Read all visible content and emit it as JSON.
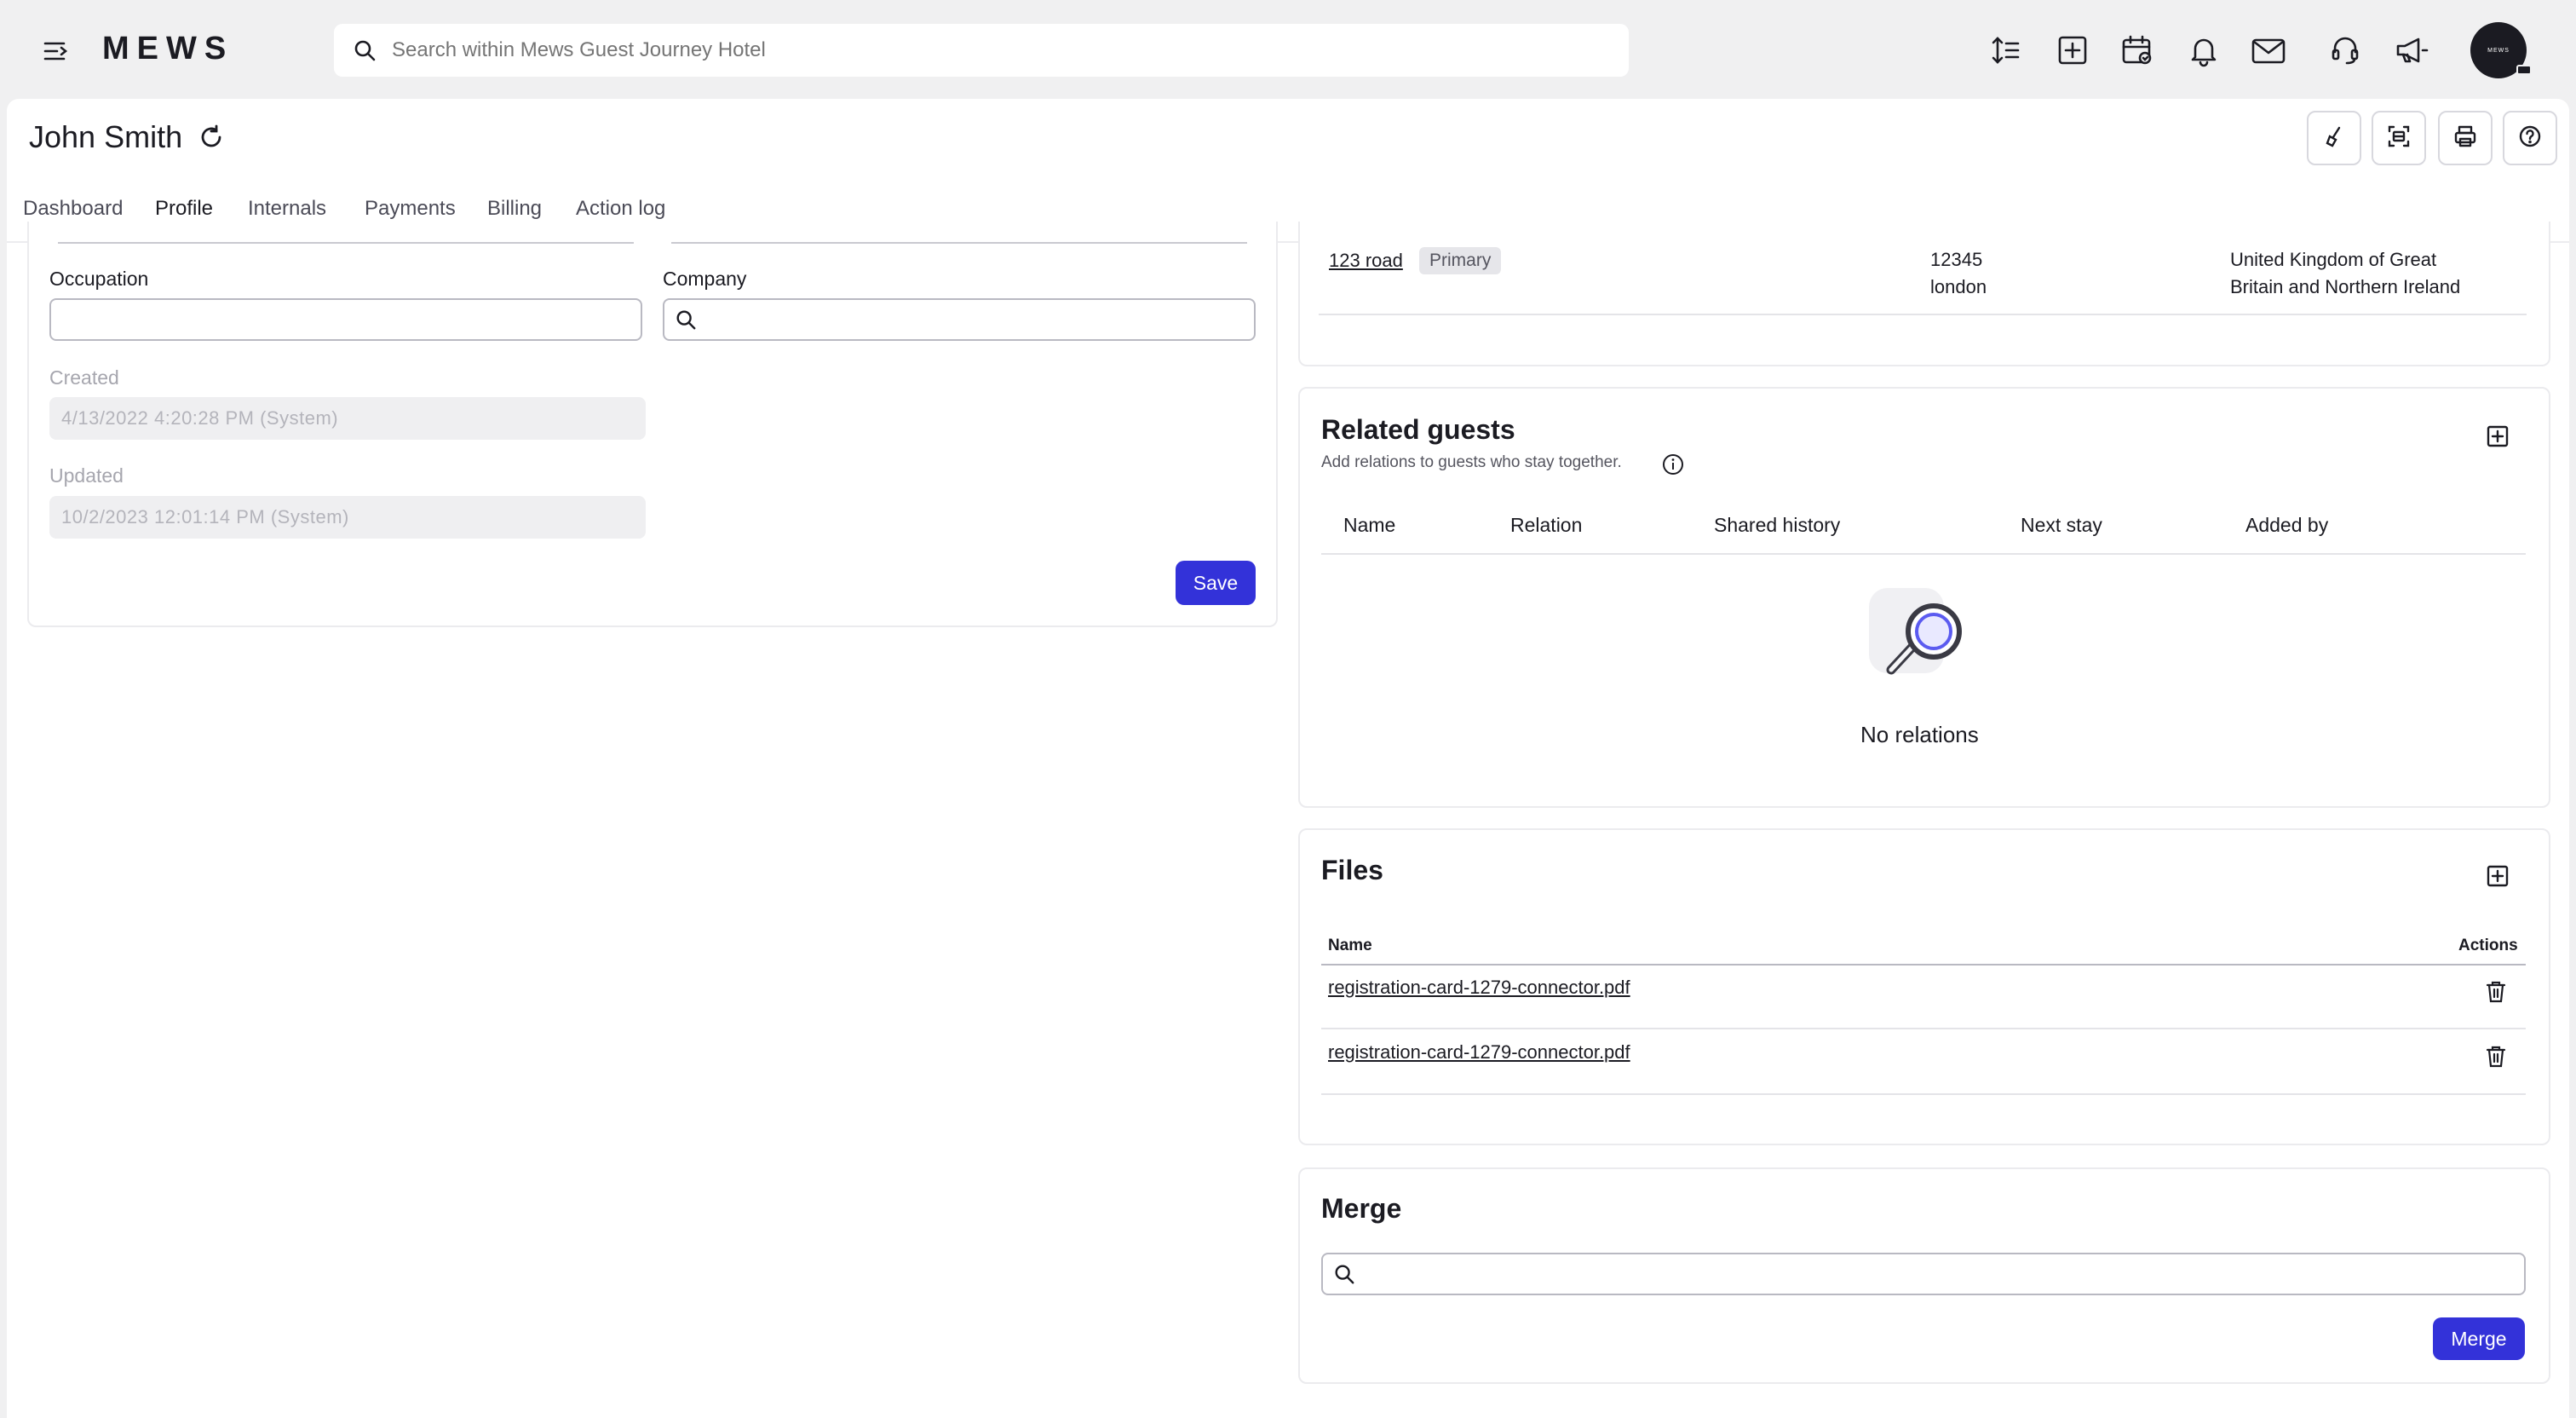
{
  "app": {
    "logo": "MEWS",
    "avatar_text": "MEWS"
  },
  "search": {
    "placeholder": "Search within Mews Guest Journey Hotel"
  },
  "header": {
    "title": "John Smith"
  },
  "tabs": [
    {
      "label": "Dashboard"
    },
    {
      "label": "Profile"
    },
    {
      "label": "Internals"
    },
    {
      "label": "Payments"
    },
    {
      "label": "Billing"
    },
    {
      "label": "Action log"
    }
  ],
  "active_tab": "Profile",
  "profile_form": {
    "occupation_label": "Occupation",
    "occupation_value": "",
    "company_label": "Company",
    "company_value": "",
    "created_label": "Created",
    "created_value": "4/13/2022 4:20:28 PM (System)",
    "updated_label": "Updated",
    "updated_value": "10/2/2023 12:01:14 PM (System)",
    "save_label": "Save"
  },
  "address": {
    "street": "123 road",
    "badge": "Primary",
    "postal_code": "12345",
    "city": "london",
    "country_line1": "United Kingdom of Great",
    "country_line2": "Britain and Northern Ireland"
  },
  "related_guests": {
    "title": "Related guests",
    "subtitle": "Add relations to guests who stay together.",
    "columns": [
      "Name",
      "Relation",
      "Shared history",
      "Next stay",
      "Added by"
    ],
    "empty_text": "No relations"
  },
  "files": {
    "title": "Files",
    "col_name": "Name",
    "col_actions": "Actions",
    "items": [
      {
        "name": "registration-card-1279-connector.pdf"
      },
      {
        "name": "registration-card-1279-connector.pdf"
      }
    ]
  },
  "merge": {
    "title": "Merge",
    "search_value": "",
    "button_label": "Merge"
  },
  "colors": {
    "accent": "#3332d9",
    "tab_indicator": "#3d3fe0",
    "background": "#f0f0f1"
  },
  "icons": {
    "menu": "menu-icon",
    "search": "search-icon",
    "top_actions": [
      "sort-icon",
      "add-square-icon",
      "calendar-icon",
      "bell-icon",
      "mail-icon",
      "support-icon",
      "megaphone-icon"
    ],
    "tools": [
      "broom-icon",
      "scan-icon",
      "printer-icon",
      "help-icon"
    ]
  }
}
